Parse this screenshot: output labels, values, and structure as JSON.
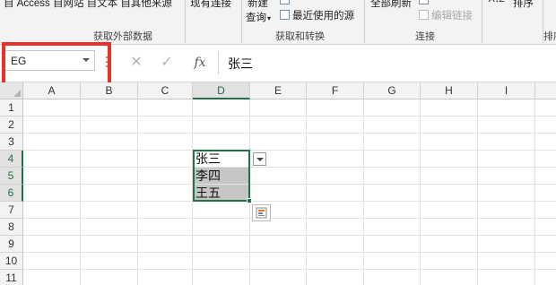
{
  "ribbon": {
    "data_sources": "自 Access  自网站  自文本  自其他来源",
    "existing_connections": "现有连接",
    "new_query_line1": "新建",
    "new_query_line2": "查询",
    "recent_sources": "最近使用的源",
    "refresh_all": "全部刷新",
    "edit_links": "编辑链接",
    "sort": "排序",
    "group_external_data": "获取外部数据",
    "group_get_transform": "获取和转换",
    "group_connections": "连接",
    "group_sort_partial": "排序"
  },
  "formula_bar": {
    "name_box": "EG",
    "cancel_icon": "cancel-icon",
    "enter_icon": "enter-icon",
    "fx_label": "fx",
    "content": "张三"
  },
  "grid": {
    "columns": [
      "A",
      "B",
      "C",
      "D",
      "E",
      "F",
      "G",
      "H",
      "I"
    ],
    "rows": [
      "1",
      "2",
      "3",
      "4",
      "5",
      "6",
      "7",
      "8",
      "9",
      "10",
      "11"
    ],
    "selected_column": "D",
    "selected_rows": [
      "4",
      "5",
      "6"
    ],
    "cells": {
      "D4": "张三",
      "D5": "李四",
      "D6": "王五"
    },
    "accent_color": "#217346",
    "highlight_color": "#e8302c"
  }
}
